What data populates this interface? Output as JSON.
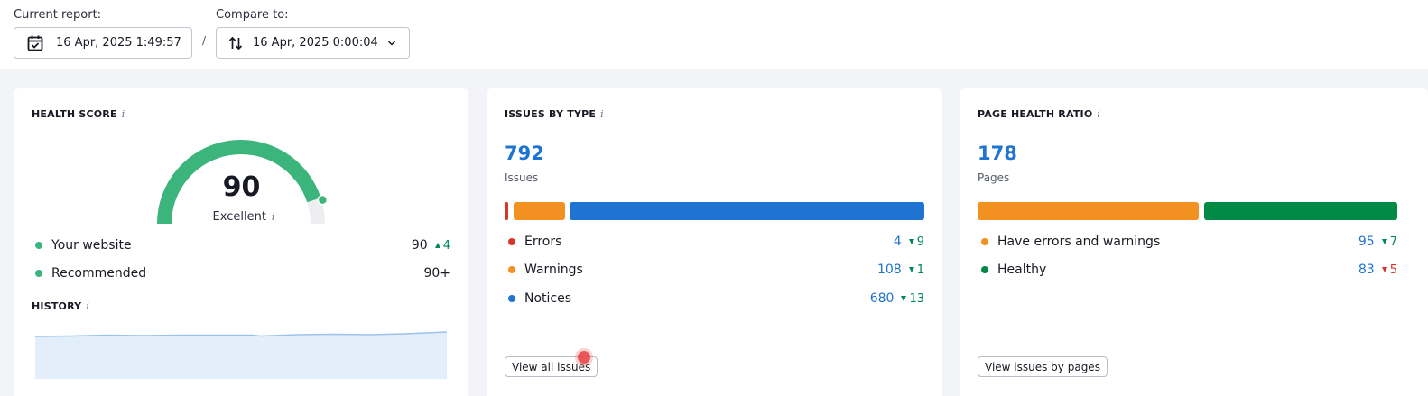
{
  "header": {
    "current_label": "Current report:",
    "current_value": "16 Apr, 2025 1:49:57",
    "separator": "/",
    "compare_label": "Compare to:",
    "compare_value": "16 Apr, 2025 0:00:04"
  },
  "health": {
    "title": "HEALTH SCORE",
    "info": "i",
    "score": "90",
    "score_fraction": 0.9,
    "rating": "Excellent",
    "rating_info": "i",
    "your_label": "Your website",
    "your_value": "90",
    "your_delta": "4",
    "rec_label": "Recommended",
    "rec_value": "90+",
    "history_title": "HISTORY",
    "history_info": "i",
    "color": "#3bb57b"
  },
  "issues": {
    "title": "ISSUES BY TYPE",
    "info": "i",
    "total": "792",
    "total_label": "Issues",
    "rows": [
      {
        "label": "Errors",
        "value": "4",
        "delta": "9",
        "color": "#d6372b"
      },
      {
        "label": "Warnings",
        "value": "108",
        "delta": "1",
        "color": "#f29022"
      },
      {
        "label": "Notices",
        "value": "680",
        "delta": "13",
        "color": "#1f73d1"
      }
    ],
    "button": "View all issues"
  },
  "pages": {
    "title": "PAGE HEALTH RATIO",
    "info": "i",
    "total": "178",
    "total_label": "Pages",
    "rows": [
      {
        "label": "Have errors and warnings",
        "value": "95",
        "delta": "7",
        "delta_color": "green",
        "color": "#f29022"
      },
      {
        "label": "Healthy",
        "value": "83",
        "delta": "5",
        "delta_color": "red",
        "color": "#008a45"
      }
    ],
    "button": "View issues by pages"
  }
}
